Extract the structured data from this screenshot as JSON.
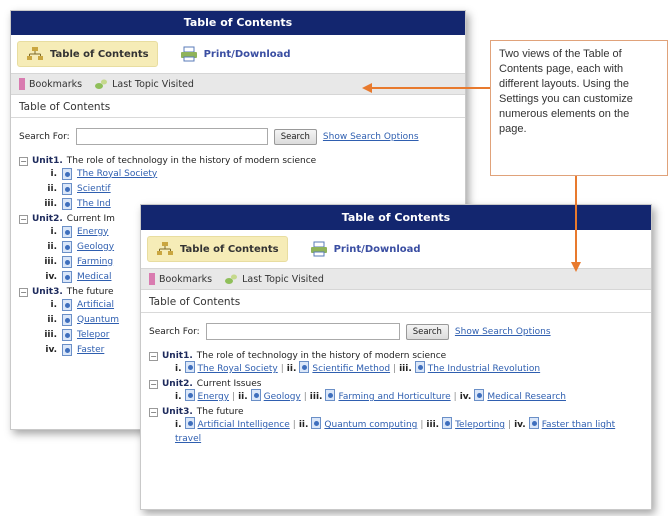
{
  "panel1": {
    "title": "Table of Contents",
    "tab_toc": "Table of Contents",
    "tab_print": "Print/Download",
    "bookmarks": "Bookmarks",
    "last_topic": "Last Topic Visited",
    "section_heading": "Table of Contents",
    "search_label": "Search For:",
    "search_button": "Search",
    "search_options": "Show Search Options",
    "units": [
      {
        "label": "Unit1.",
        "title": "The role of technology in the history of modern science",
        "topics": [
          {
            "num": "i.",
            "text": "The Royal Society"
          },
          {
            "num": "ii.",
            "text": "Scientif"
          },
          {
            "num": "iii.",
            "text": "The Ind"
          }
        ]
      },
      {
        "label": "Unit2.",
        "title": "Current Im",
        "topics": [
          {
            "num": "i.",
            "text": "Energy"
          },
          {
            "num": "ii.",
            "text": "Geology"
          },
          {
            "num": "iii.",
            "text": "Farming"
          },
          {
            "num": "iv.",
            "text": "Medical"
          }
        ]
      },
      {
        "label": "Unit3.",
        "title": "The future",
        "topics": [
          {
            "num": "i.",
            "text": "Artificial"
          },
          {
            "num": "ii.",
            "text": "Quantum"
          },
          {
            "num": "iii.",
            "text": "Telepor"
          },
          {
            "num": "iv.",
            "text": "Faster"
          }
        ]
      }
    ]
  },
  "panel2": {
    "title": "Table of Contents",
    "tab_toc": "Table of Contents",
    "tab_print": "Print/Download",
    "bookmarks": "Bookmarks",
    "last_topic": "Last Topic Visited",
    "section_heading": "Table of Contents",
    "search_label": "Search For:",
    "search_button": "Search",
    "search_options": "Show Search Options",
    "units": [
      {
        "label": "Unit1.",
        "title": "The role of technology in the history of modern science",
        "topics": [
          "The Royal Society",
          "Scientific Method",
          "The Industrial Revolution"
        ]
      },
      {
        "label": "Unit2.",
        "title": "Current Issues",
        "topics": [
          "Energy",
          "Geology",
          "Farming and Horticulture",
          "Medical Research"
        ]
      },
      {
        "label": "Unit3.",
        "title": "The future",
        "topics": [
          "Artificial Intelligence",
          "Quantum computing",
          "Teleporting",
          "Faster than light travel"
        ]
      }
    ]
  },
  "callout": {
    "text": "Two views of the Table of Contents page, each with different layouts. Using the Settings you can customize numerous elements on the page."
  },
  "colors": {
    "titlebar": "#13266f",
    "accent": "#e87a2e",
    "link": "#2f5fb0"
  }
}
